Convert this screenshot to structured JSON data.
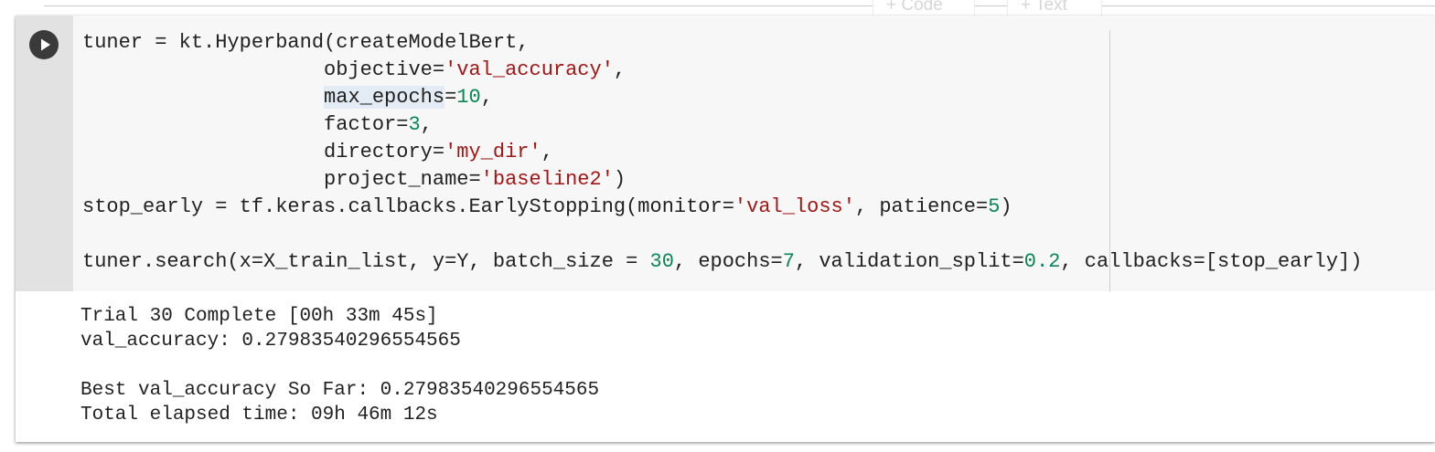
{
  "toolbar": {
    "add_code_label": "+ Code",
    "add_text_label": "+ Text"
  },
  "cell": {
    "run_icon": "play-icon",
    "code_lines": [
      [
        {
          "t": "tuner = kt.Hyperband(createModelBert,"
        }
      ],
      [
        {
          "t": "                    objective="
        },
        {
          "t": "'val_accuracy'",
          "c": "str"
        },
        {
          "t": ","
        }
      ],
      [
        {
          "t": "                    "
        },
        {
          "t": "max_epochs",
          "c": "sel"
        },
        {
          "t": "="
        },
        {
          "t": "10",
          "c": "num"
        },
        {
          "t": ","
        }
      ],
      [
        {
          "t": "                    factor="
        },
        {
          "t": "3",
          "c": "num"
        },
        {
          "t": ","
        }
      ],
      [
        {
          "t": "                    directory="
        },
        {
          "t": "'my_dir'",
          "c": "str"
        },
        {
          "t": ","
        }
      ],
      [
        {
          "t": "                    project_name="
        },
        {
          "t": "'baseline2'",
          "c": "str"
        },
        {
          "t": ")"
        }
      ],
      [
        {
          "t": "stop_early = tf.keras.callbacks.EarlyStopping(monitor="
        },
        {
          "t": "'val_loss'",
          "c": "str"
        },
        {
          "t": ", patience="
        },
        {
          "t": "5",
          "c": "num"
        },
        {
          "t": ")"
        }
      ],
      [
        {
          "t": ""
        }
      ],
      [
        {
          "t": "tuner.search(x=X_train_list, y=Y, batch_size = "
        },
        {
          "t": "30",
          "c": "num"
        },
        {
          "t": ", epochs="
        },
        {
          "t": "7",
          "c": "num"
        },
        {
          "t": ", validation_split="
        },
        {
          "t": "0.2",
          "c": "num"
        },
        {
          "t": ", callbacks=[stop_early])"
        }
      ]
    ],
    "output_lines": [
      "Trial 30 Complete [00h 33m 45s]",
      "val_accuracy: 0.27983540296554565",
      "",
      "Best val_accuracy So Far: 0.27983540296554565",
      "Total elapsed time: 09h 46m 12s"
    ]
  },
  "colors": {
    "string": "#a31515",
    "number": "#098658",
    "text": "#212121",
    "editor_bg": "#f7f7f7",
    "gutter_bg": "#e2e2e2"
  }
}
